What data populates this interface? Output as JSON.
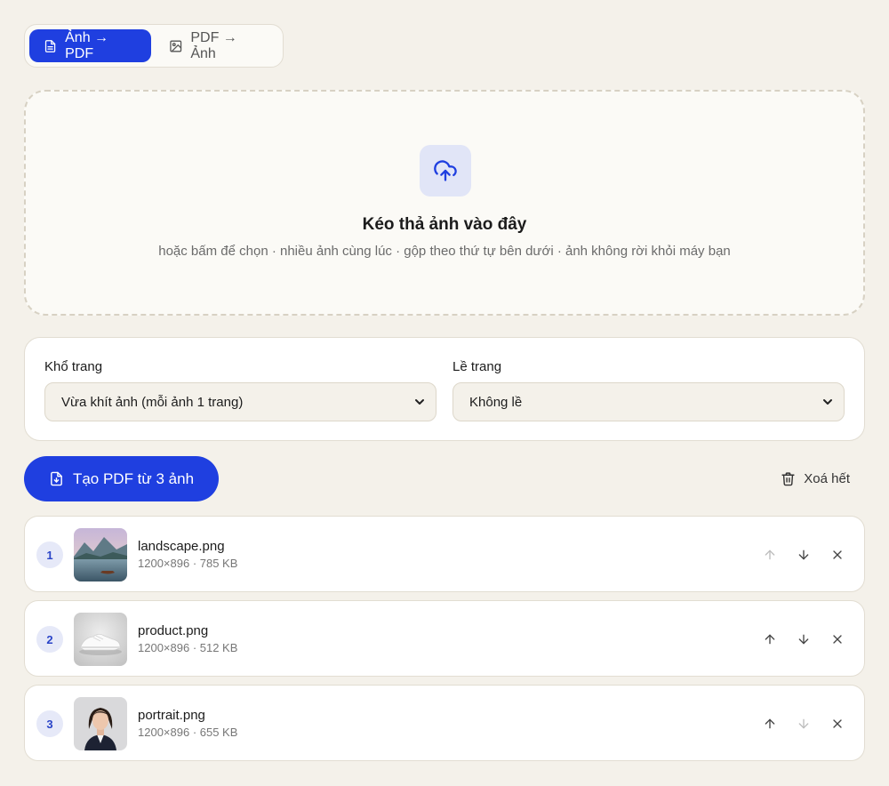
{
  "tabs": [
    {
      "label": "Ảnh → PDF",
      "icon": "file-icon",
      "active": true
    },
    {
      "label": "PDF → Ảnh",
      "icon": "image-icon",
      "active": false
    }
  ],
  "dropzone": {
    "icon": "cloud-upload-icon",
    "title": "Kéo thả ảnh vào đây",
    "subtitle": "hoặc bấm để chọn · nhiều ảnh cùng lúc · gộp theo thứ tự bên dưới · ảnh không rời khỏi máy bạn"
  },
  "options": {
    "page_size": {
      "label": "Khổ trang",
      "value": "Vừa khít ảnh (mỗi ảnh 1 trang)"
    },
    "margin": {
      "label": "Lề trang",
      "value": "Không lề"
    }
  },
  "actions": {
    "create_label": "Tạo PDF từ 3 ảnh",
    "clear_label": "Xoá hết"
  },
  "files": [
    {
      "index": "1",
      "name": "landscape.png",
      "meta": "1200×896 · 785 KB",
      "thumb": "landscape",
      "can_up": false,
      "can_down": true
    },
    {
      "index": "2",
      "name": "product.png",
      "meta": "1200×896 · 512 KB",
      "thumb": "product",
      "can_up": true,
      "can_down": true
    },
    {
      "index": "3",
      "name": "portrait.png",
      "meta": "1200×896 · 655 KB",
      "thumb": "portrait",
      "can_up": true,
      "can_down": false
    }
  ],
  "colors": {
    "accent": "#1f3fe0",
    "background": "#f4f1ea",
    "badge_bg": "#e6e9f8"
  }
}
